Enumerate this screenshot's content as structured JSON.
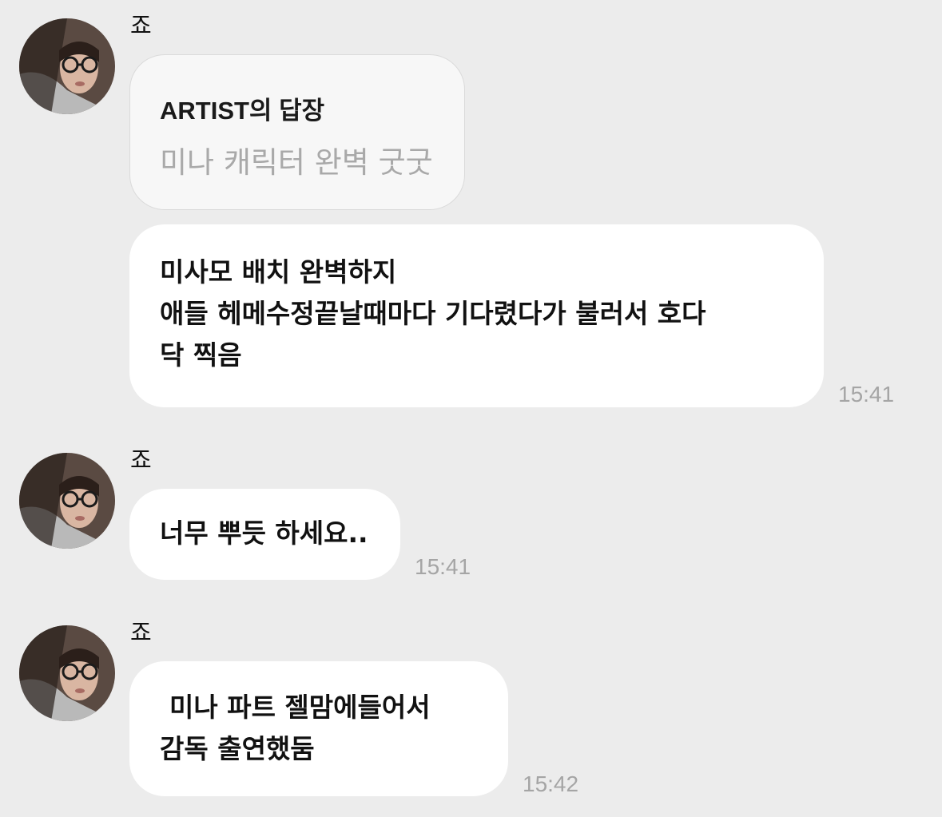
{
  "messages": [
    {
      "sender": "죠",
      "reply": {
        "title": "ARTIST의 답장",
        "quoted_text": "미나 캐릭터 완벽 굿굿"
      },
      "lines": [
        "미사모 배치 완벽하지",
        "애들 헤메수정끝날때마다 기다렸다가 불러서 호다",
        "닥 찍음"
      ],
      "time": "15:41"
    },
    {
      "sender": "죠",
      "lines": [
        "너무 뿌듯 하세요.."
      ],
      "time": "15:41"
    },
    {
      "sender": "죠",
      "lines": [
        "미나 파트 젤맘에들어서",
        "감독 출연했둠"
      ],
      "time": "15:42"
    }
  ],
  "icons": {
    "avatar": "profile-photo"
  },
  "colors": {
    "background": "#ececec",
    "bubble": "#ffffff",
    "reply_bubble": "#f7f7f7",
    "timestamp": "#a5a5a5"
  }
}
